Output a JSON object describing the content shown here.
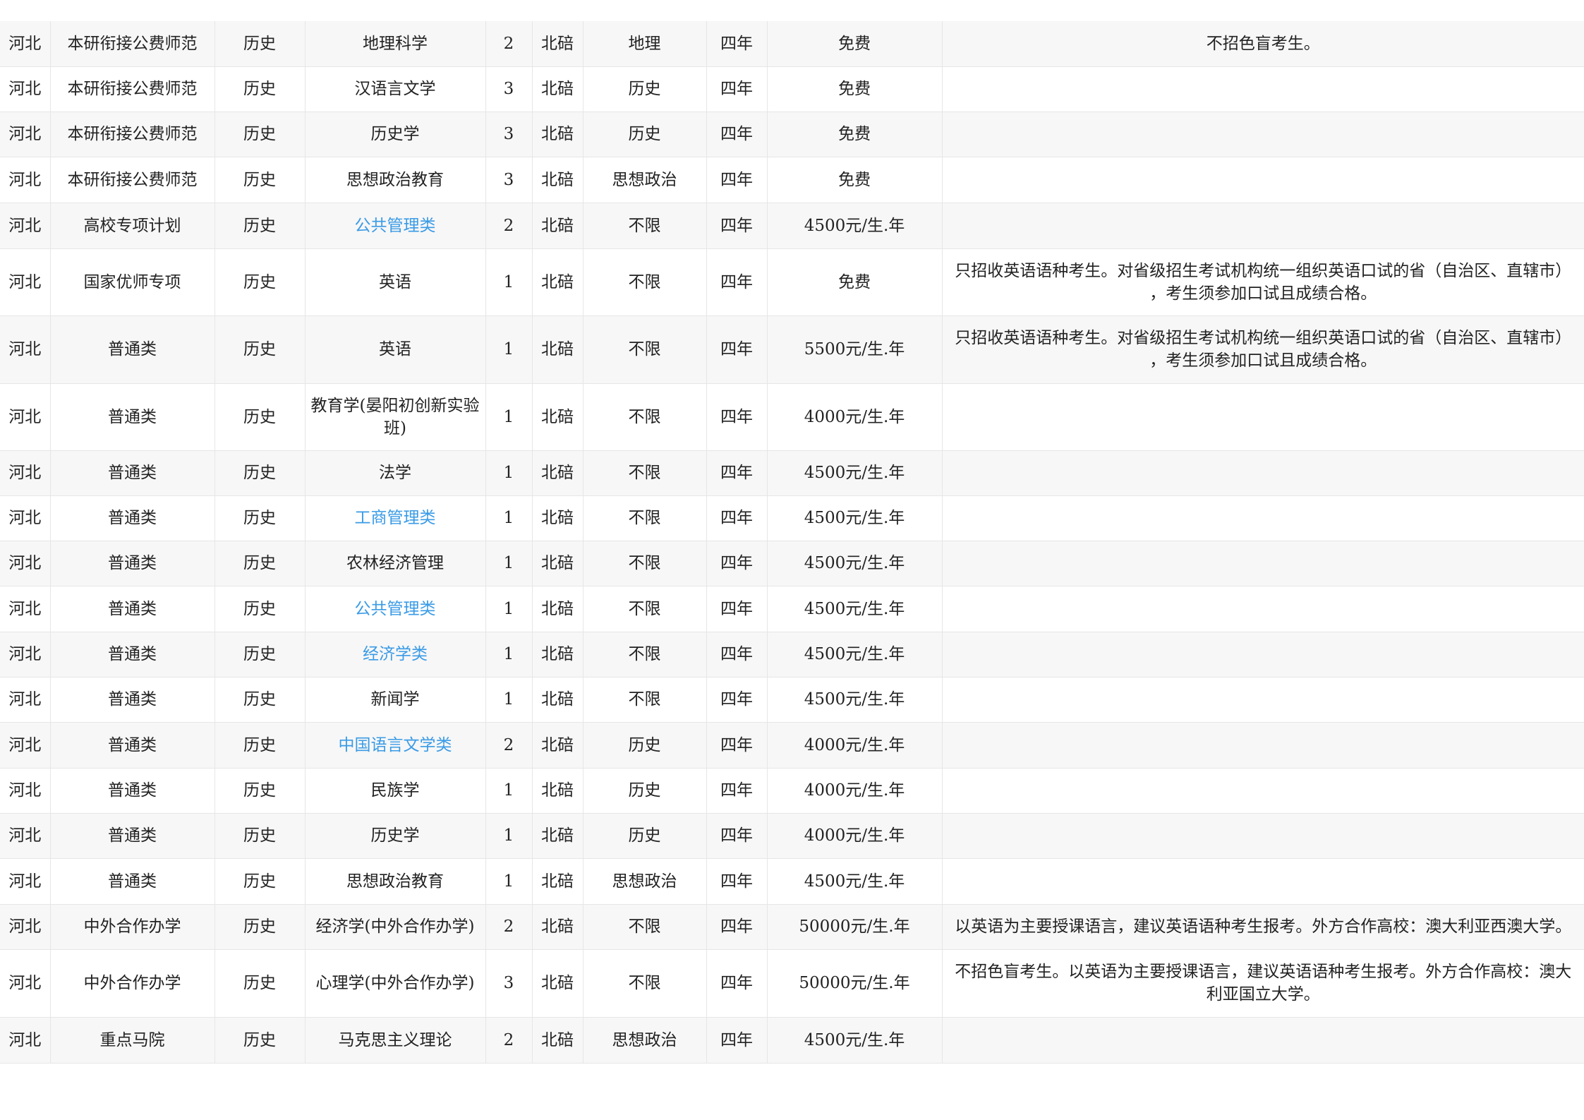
{
  "rows": [
    {
      "province": "河北",
      "category": "本研衔接公费师范",
      "subject": "历史",
      "major": "地理科学",
      "count": "2",
      "campus": "北碚",
      "requirement": "地理",
      "duration": "四年",
      "fee": "免费",
      "note": "不招色盲考生。",
      "link": false
    },
    {
      "province": "河北",
      "category": "本研衔接公费师范",
      "subject": "历史",
      "major": "汉语言文学",
      "count": "3",
      "campus": "北碚",
      "requirement": "历史",
      "duration": "四年",
      "fee": "免费",
      "note": "",
      "link": false
    },
    {
      "province": "河北",
      "category": "本研衔接公费师范",
      "subject": "历史",
      "major": "历史学",
      "count": "3",
      "campus": "北碚",
      "requirement": "历史",
      "duration": "四年",
      "fee": "免费",
      "note": "",
      "link": false
    },
    {
      "province": "河北",
      "category": "本研衔接公费师范",
      "subject": "历史",
      "major": "思想政治教育",
      "count": "3",
      "campus": "北碚",
      "requirement": "思想政治",
      "duration": "四年",
      "fee": "免费",
      "note": "",
      "link": false
    },
    {
      "province": "河北",
      "category": "高校专项计划",
      "subject": "历史",
      "major": "公共管理类",
      "count": "2",
      "campus": "北碚",
      "requirement": "不限",
      "duration": "四年",
      "fee": "4500元/生.年",
      "note": "",
      "link": true
    },
    {
      "province": "河北",
      "category": "国家优师专项",
      "subject": "历史",
      "major": "英语",
      "count": "1",
      "campus": "北碚",
      "requirement": "不限",
      "duration": "四年",
      "fee": "免费",
      "note": "只招收英语语种考生。对省级招生考试机构统一组织英语口试的省（自治区、直辖市）\n，考生须参加口试且成绩合格。",
      "link": false
    },
    {
      "province": "河北",
      "category": "普通类",
      "subject": "历史",
      "major": "英语",
      "count": "1",
      "campus": "北碚",
      "requirement": "不限",
      "duration": "四年",
      "fee": "5500元/生.年",
      "note": "只招收英语语种考生。对省级招生考试机构统一组织英语口试的省（自治区、直辖市）\n，考生须参加口试且成绩合格。",
      "link": false
    },
    {
      "province": "河北",
      "category": "普通类",
      "subject": "历史",
      "major": "教育学(晏阳初创新实验班)",
      "count": "1",
      "campus": "北碚",
      "requirement": "不限",
      "duration": "四年",
      "fee": "4000元/生.年",
      "note": "",
      "link": false
    },
    {
      "province": "河北",
      "category": "普通类",
      "subject": "历史",
      "major": "法学",
      "count": "1",
      "campus": "北碚",
      "requirement": "不限",
      "duration": "四年",
      "fee": "4500元/生.年",
      "note": "",
      "link": false
    },
    {
      "province": "河北",
      "category": "普通类",
      "subject": "历史",
      "major": "工商管理类",
      "count": "1",
      "campus": "北碚",
      "requirement": "不限",
      "duration": "四年",
      "fee": "4500元/生.年",
      "note": "",
      "link": true
    },
    {
      "province": "河北",
      "category": "普通类",
      "subject": "历史",
      "major": "农林经济管理",
      "count": "1",
      "campus": "北碚",
      "requirement": "不限",
      "duration": "四年",
      "fee": "4500元/生.年",
      "note": "",
      "link": false
    },
    {
      "province": "河北",
      "category": "普通类",
      "subject": "历史",
      "major": "公共管理类",
      "count": "1",
      "campus": "北碚",
      "requirement": "不限",
      "duration": "四年",
      "fee": "4500元/生.年",
      "note": "",
      "link": true
    },
    {
      "province": "河北",
      "category": "普通类",
      "subject": "历史",
      "major": "经济学类",
      "count": "1",
      "campus": "北碚",
      "requirement": "不限",
      "duration": "四年",
      "fee": "4500元/生.年",
      "note": "",
      "link": true
    },
    {
      "province": "河北",
      "category": "普通类",
      "subject": "历史",
      "major": "新闻学",
      "count": "1",
      "campus": "北碚",
      "requirement": "不限",
      "duration": "四年",
      "fee": "4500元/生.年",
      "note": "",
      "link": false
    },
    {
      "province": "河北",
      "category": "普通类",
      "subject": "历史",
      "major": "中国语言文学类",
      "count": "2",
      "campus": "北碚",
      "requirement": "历史",
      "duration": "四年",
      "fee": "4000元/生.年",
      "note": "",
      "link": true
    },
    {
      "province": "河北",
      "category": "普通类",
      "subject": "历史",
      "major": "民族学",
      "count": "1",
      "campus": "北碚",
      "requirement": "历史",
      "duration": "四年",
      "fee": "4000元/生.年",
      "note": "",
      "link": false
    },
    {
      "province": "河北",
      "category": "普通类",
      "subject": "历史",
      "major": "历史学",
      "count": "1",
      "campus": "北碚",
      "requirement": "历史",
      "duration": "四年",
      "fee": "4000元/生.年",
      "note": "",
      "link": false
    },
    {
      "province": "河北",
      "category": "普通类",
      "subject": "历史",
      "major": "思想政治教育",
      "count": "1",
      "campus": "北碚",
      "requirement": "思想政治",
      "duration": "四年",
      "fee": "4500元/生.年",
      "note": "",
      "link": false
    },
    {
      "province": "河北",
      "category": "中外合作办学",
      "subject": "历史",
      "major": "经济学(中外合作办学)",
      "count": "2",
      "campus": "北碚",
      "requirement": "不限",
      "duration": "四年",
      "fee": "50000元/生.年",
      "note": "以英语为主要授课语言，建议英语语种考生报考。外方合作高校：澳大利亚西澳大学。",
      "link": false
    },
    {
      "province": "河北",
      "category": "中外合作办学",
      "subject": "历史",
      "major": "心理学(中外合作办学)",
      "count": "3",
      "campus": "北碚",
      "requirement": "不限",
      "duration": "四年",
      "fee": "50000元/生.年",
      "note": "不招色盲考生。以英语为主要授课语言，建议英语语种考生报考。外方合作高校：澳大\n利亚国立大学。",
      "link": false
    },
    {
      "province": "河北",
      "category": "重点马院",
      "subject": "历史",
      "major": "马克思主义理论",
      "count": "2",
      "campus": "北碚",
      "requirement": "思想政治",
      "duration": "四年",
      "fee": "4500元/生.年",
      "note": "",
      "link": false
    }
  ]
}
